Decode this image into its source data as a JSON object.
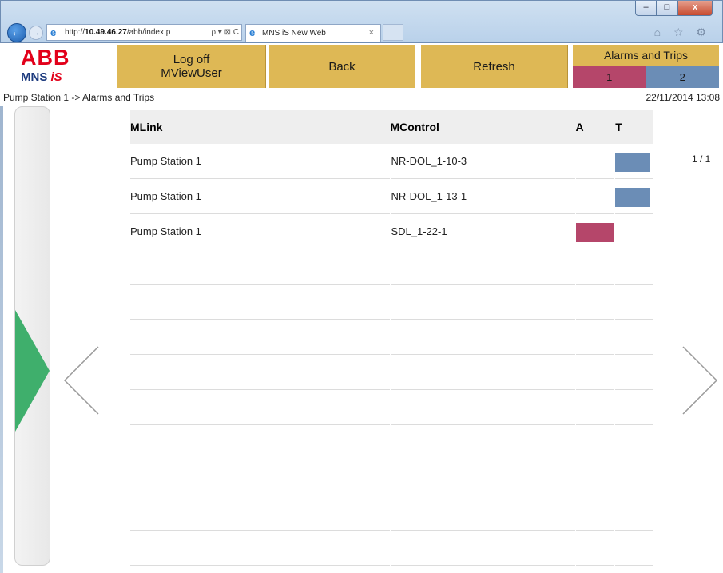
{
  "browser": {
    "url_prefix": "http://",
    "url_host": "10.49.46.27",
    "url_path": "/abb/index.p",
    "addr_tools": "ρ ▾ ⊠ C",
    "tab_title": "MNS iS New Web",
    "tab_close": "×",
    "window_buttons": [
      "–",
      "□",
      "x"
    ],
    "chrome_icons": "⌂ ☆ ⚙"
  },
  "logo": {
    "brand": "ABB",
    "product": "MNS",
    "product_suffix": "iS"
  },
  "header": {
    "logoff_line1": "Log off",
    "logoff_line2": "MViewUser",
    "back": "Back",
    "refresh": "Refresh",
    "alarms_title": "Alarms and Trips",
    "alarms_count": "1",
    "trips_count": "2"
  },
  "breadcrumb": "Pump Station 1 -> Alarms and Trips",
  "datetime": "22/11/2014 13:08",
  "page_indicator": "1 / 1",
  "colors": {
    "alarm": "#b5466a",
    "trip": "#6b8db6",
    "button": "#deb855",
    "nav_green": "#3faf6c"
  },
  "table": {
    "headers": {
      "mlink": "MLink",
      "mcontrol": "MControl",
      "a": "A",
      "t": "T"
    },
    "rows": [
      {
        "mlink": "Pump Station 1",
        "mcontrol": "NR-DOL_1-10-3",
        "alarm": false,
        "trip": true
      },
      {
        "mlink": "Pump Station 1",
        "mcontrol": "NR-DOL_1-13-1",
        "alarm": false,
        "trip": true
      },
      {
        "mlink": "Pump Station 1",
        "mcontrol": "SDL_1-22-1",
        "alarm": true,
        "trip": false
      },
      {
        "mlink": "",
        "mcontrol": "",
        "alarm": false,
        "trip": false
      },
      {
        "mlink": "",
        "mcontrol": "",
        "alarm": false,
        "trip": false
      },
      {
        "mlink": "",
        "mcontrol": "",
        "alarm": false,
        "trip": false
      },
      {
        "mlink": "",
        "mcontrol": "",
        "alarm": false,
        "trip": false
      },
      {
        "mlink": "",
        "mcontrol": "",
        "alarm": false,
        "trip": false
      },
      {
        "mlink": "",
        "mcontrol": "",
        "alarm": false,
        "trip": false
      },
      {
        "mlink": "",
        "mcontrol": "",
        "alarm": false,
        "trip": false
      },
      {
        "mlink": "",
        "mcontrol": "",
        "alarm": false,
        "trip": false
      },
      {
        "mlink": "",
        "mcontrol": "",
        "alarm": false,
        "trip": false
      }
    ]
  }
}
